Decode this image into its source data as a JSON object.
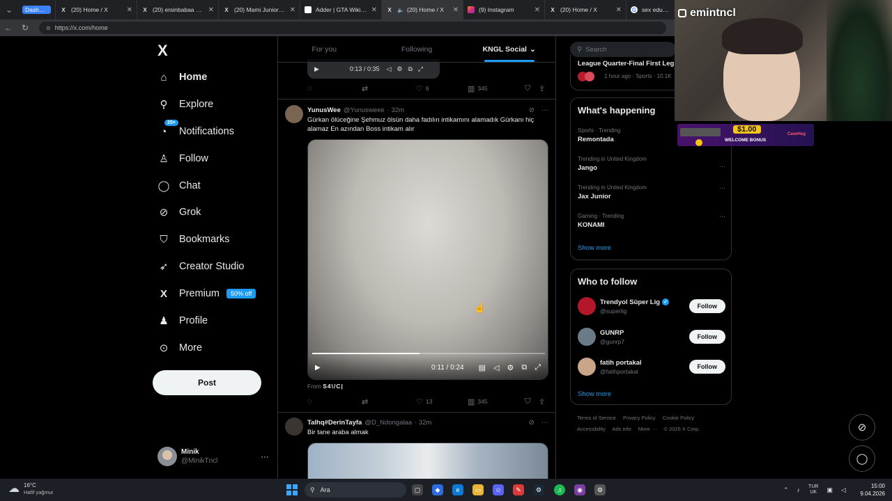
{
  "browser": {
    "tabs": [
      {
        "label": "Dashboard",
        "icon": "dashboard-badge",
        "type": "group"
      },
      {
        "label": "(20) Home / X",
        "icon": "x-logo-icon"
      },
      {
        "label": "(20) ersinbabaa on X:",
        "icon": "x-logo-icon"
      },
      {
        "label": "(20) Mami Junior on X:",
        "icon": "x-logo-icon"
      },
      {
        "label": "Adder | GTA Wiki | Fan",
        "icon": "wiki-icon"
      },
      {
        "label": "(20) Home / X",
        "icon": "x-logo-icon",
        "active": true
      },
      {
        "label": "(9) Instagram",
        "icon": "instagram-icon"
      },
      {
        "label": "(20) Home / X",
        "icon": "x-logo-icon"
      },
      {
        "label": "sex education",
        "icon": "google-icon"
      }
    ],
    "url": "https://x.com/home"
  },
  "sidebar": {
    "logo": "X",
    "items": [
      {
        "label": "Home",
        "icon": "home-icon"
      },
      {
        "label": "Explore",
        "icon": "search-icon"
      },
      {
        "label": "Notifications",
        "icon": "bell-icon",
        "badge": "20+"
      },
      {
        "label": "Follow",
        "icon": "add-person-icon"
      },
      {
        "label": "Chat",
        "icon": "chat-bubble-icon"
      },
      {
        "label": "Grok",
        "icon": "grok-icon"
      },
      {
        "label": "Bookmarks",
        "icon": "bookmark-icon"
      },
      {
        "label": "Creator Studio",
        "icon": "rocket-icon"
      },
      {
        "label": "Premium",
        "icon": "x-logo-icon",
        "badge": "50% off"
      },
      {
        "label": "Profile",
        "icon": "person-icon"
      },
      {
        "label": "More",
        "icon": "more-circle-icon"
      }
    ],
    "post_label": "Post",
    "user": {
      "name": "Minik",
      "handle": "@MinikTncl"
    }
  },
  "feed": {
    "tabs": [
      {
        "label": "For you"
      },
      {
        "label": "Following"
      },
      {
        "label": "KNGL Social",
        "active": true
      }
    ],
    "prev_tweet": {
      "video_time": "0:13 / 0:35",
      "likes": "6",
      "views": "345"
    },
    "tweets": [
      {
        "name": "YunusWee",
        "handle": "@Yunusweee",
        "time": "· 32m",
        "text": "Gürkan ölüceğine Şehmuz ölsün daha fadılın intikamını alamadık Gürkanı hiç alamaz En azından Boss intikam alır",
        "video_time": "0:11 / 0:24",
        "progress": 0.46,
        "from_label": "From",
        "from_source": "S4\\/C|",
        "likes": "13",
        "views": "345"
      },
      {
        "name": "Talhq#DerinTayfa",
        "handle": "@D_Ndongalaa",
        "time": "· 32m",
        "text": "Bir tane araba almak"
      }
    ]
  },
  "right": {
    "search_placeholder": "Search",
    "top_card": {
      "title": "League Quarter-Final First Leg",
      "meta": "1 hour ago · Sports · 10.1K"
    },
    "happening": {
      "title": "What's happening",
      "trends": [
        {
          "context": "Sports · Trending",
          "name": "Remontada"
        },
        {
          "context": "Trending in United Kingdom",
          "name": "Jango"
        },
        {
          "context": "Trending in United Kingdom",
          "name": "Jax Junior"
        },
        {
          "context": "Gaming · Trending",
          "name": "KONAMI"
        }
      ],
      "show_more": "Show more"
    },
    "who_to_follow": {
      "title": "Who to follow",
      "users": [
        {
          "name": "Trendyol Süper Lig",
          "handle": "@superlig",
          "verified": true,
          "color": "#b3172a"
        },
        {
          "name": "GUNRP",
          "handle": "@gunrp7",
          "verified": false,
          "color": "#6a7a86"
        },
        {
          "name": "fatih portakal",
          "handle": "@fatihportakal",
          "verified": false,
          "color": "#c9a58a"
        }
      ],
      "follow_label": "Follow",
      "show_more": "Show more"
    },
    "footer": {
      "links": [
        "Terms of Service",
        "Privacy Policy",
        "Cookie Policy",
        "Accessibility",
        "Ads info",
        "More ···"
      ],
      "copyright": "© 2026 X Corp."
    }
  },
  "overlay": {
    "streamer_handle": "emintncl",
    "ad_amount": "$1.00",
    "ad_text": "WELCOME BONUS",
    "ad_brand": "CaseHug"
  },
  "taskbar": {
    "weather_temp": "16°C",
    "weather_desc": "Hafif yağmur",
    "search_label": "Ara",
    "lang_top": "TUR",
    "lang_bottom": "UK",
    "time": "15:00",
    "date": "9.04.2026"
  },
  "colors": {
    "accent": "#1d9bf0",
    "background": "#000000",
    "border": "#2f3336"
  }
}
